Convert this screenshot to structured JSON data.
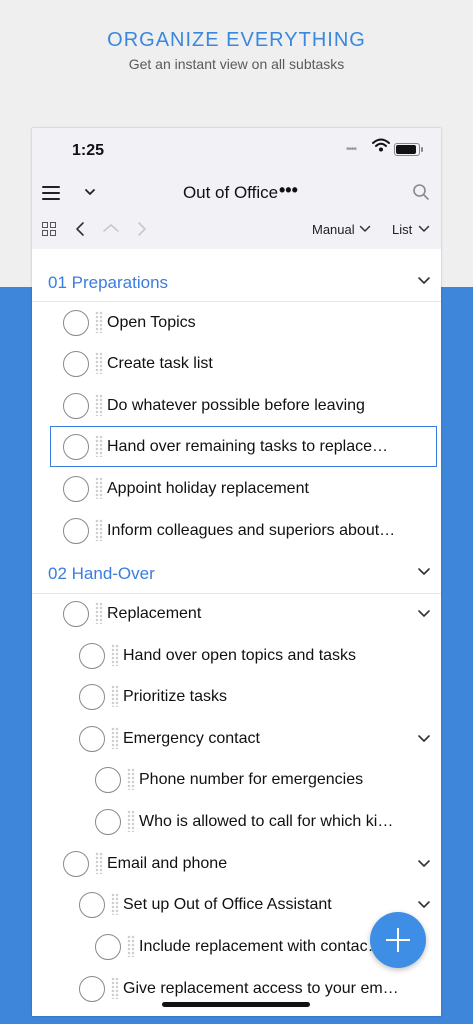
{
  "promo": {
    "title": "ORGANIZE EVERYTHING",
    "subtitle": "Get an instant view on all subtasks"
  },
  "status_bar": {
    "time": "1:25",
    "signal": "••••"
  },
  "nav": {
    "title": "Out of Office",
    "more": "•••",
    "icons": [
      "hamburger-menu-icon",
      "chevron-down-icon",
      "more-icon",
      "search-icon"
    ]
  },
  "toolbar": {
    "sort_label": "Manual",
    "view_label": "List",
    "icons": [
      "grid-icon",
      "back-icon",
      "up-icon",
      "forward-icon"
    ]
  },
  "sections": [
    {
      "title": "01 Preparations",
      "tasks": [
        {
          "label": "Open Topics"
        },
        {
          "label": "Create task list"
        },
        {
          "label": "Do whatever possible before leaving"
        },
        {
          "label": "Hand over remaining tasks to replace…",
          "selected": true
        },
        {
          "label": "Appoint holiday replacement"
        },
        {
          "label": "Inform colleagues and superiors about…"
        }
      ]
    },
    {
      "title": "02 Hand-Over",
      "tasks": [
        {
          "label": "Replacement",
          "level": 0,
          "expandable": true
        },
        {
          "label": "Hand over open topics and tasks",
          "level": 1
        },
        {
          "label": "Prioritize tasks",
          "level": 1
        },
        {
          "label": "Emergency contact",
          "level": 1,
          "expandable": true
        },
        {
          "label": "Phone number for emergencies",
          "level": 2
        },
        {
          "label": "Who is allowed to call for which ki…",
          "level": 2
        },
        {
          "label": "Email and phone",
          "level": 0,
          "expandable": true
        },
        {
          "label": "Set up Out of Office Assistant",
          "level": 1,
          "expandable": true
        },
        {
          "label": "Include replacement with contac…",
          "level": 2
        },
        {
          "label": "Give replacement access to your em…",
          "level": 1
        }
      ]
    }
  ],
  "colors": {
    "accent": "#3a7de0",
    "band": "#3e86d9",
    "fab": "#3e8ee6"
  },
  "fab_icon": "plus-icon"
}
